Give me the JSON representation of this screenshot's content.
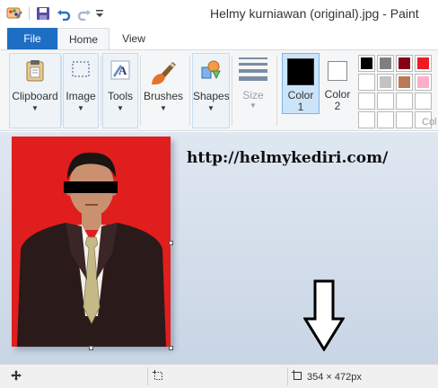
{
  "window": {
    "title": "Helmy kurniawan (original).jpg - Paint"
  },
  "quick_access": {
    "icons": [
      "paint-app-icon",
      "save-icon",
      "undo-icon",
      "redo-icon",
      "customize-dropdown-icon"
    ]
  },
  "tabs": [
    {
      "label": "File"
    },
    {
      "label": "Home"
    },
    {
      "label": "View"
    }
  ],
  "ribbon": {
    "clipboard": {
      "label": "Clipboard",
      "icon": "clipboard-icon"
    },
    "image": {
      "label": "Image",
      "icon": "select-icon"
    },
    "tools": {
      "label": "Tools",
      "icon": "tools-icon"
    },
    "brushes": {
      "label": "Brushes",
      "icon": "brush-icon"
    },
    "shapes": {
      "label": "Shapes",
      "icon": "shapes-icon"
    },
    "size": {
      "label": "Size",
      "icon": "size-lines-icon"
    },
    "color1": {
      "label": "Color\n1",
      "line1": "Color",
      "line2": "1",
      "value": "#000000"
    },
    "color2": {
      "label": "Color\n2",
      "line1": "Color",
      "line2": "2",
      "value": "#ffffff"
    },
    "colors_group_label": "Col",
    "palette": [
      [
        "#000000",
        "#7f7f7f",
        "#880015",
        "#ed1c24"
      ],
      [
        "#ffffff",
        "#c3c3c3",
        "#b97a57",
        "#ffaec9"
      ],
      [
        "#ffffff",
        "#ffffff",
        "#ffffff",
        "#ffffff"
      ],
      [
        "#ffffff",
        "#ffffff",
        "#ffffff",
        "#ffffff"
      ]
    ]
  },
  "canvas": {
    "watermark": "http://helmykediri.com/",
    "background_color": "#e01e1e"
  },
  "statusbar": {
    "cursor_icon": "move-cursor-icon",
    "selection_icon": "selection-size-icon",
    "image_size_icon": "image-size-icon",
    "image_size": "354 × 472px"
  }
}
